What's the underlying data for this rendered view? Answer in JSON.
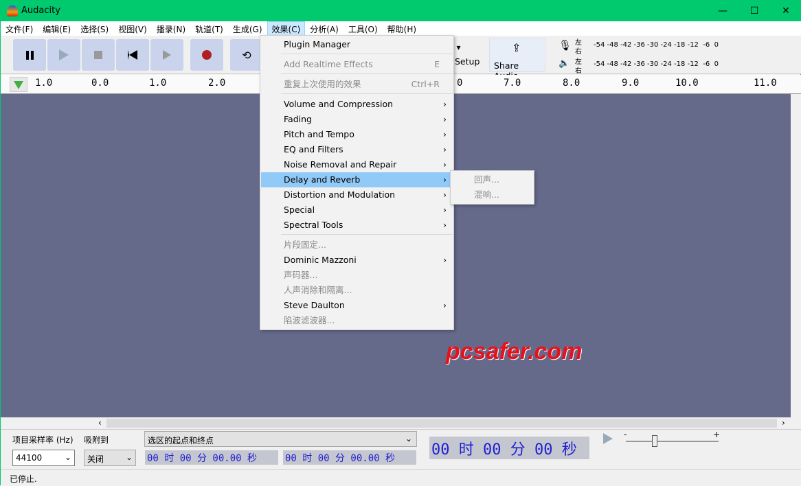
{
  "window": {
    "title": "Audacity",
    "minimize": "—",
    "maximize": "☐",
    "close": "✕"
  },
  "menubar": [
    "文件(F)",
    "编辑(E)",
    "选择(S)",
    "视图(V)",
    "播录(N)",
    "轨道(T)",
    "生成(G)",
    "效果(C)",
    "分析(A)",
    "工具(O)",
    "帮助(H)"
  ],
  "toolbar": {
    "setup_label": "Setup",
    "share_label": "Share Audio",
    "meter_left": "左",
    "meter_right": "右",
    "meter_scale": "-54 -48 -42 -36 -30 -24 -18 -12  -6  0"
  },
  "ruler": {
    "labels": [
      "1.0",
      "0.0",
      "1.0",
      "2.0",
      "0",
      "7.0",
      "8.0",
      "9.0",
      "10.0",
      "11.0"
    ]
  },
  "effects_menu": {
    "items": [
      {
        "label": "Plugin Manager",
        "enabled": true
      },
      {
        "label": "Add Realtime Effects",
        "shortcut": "E",
        "enabled": false
      },
      {
        "label": "重复上次使用的效果",
        "shortcut": "Ctrl+R",
        "enabled": false
      },
      {
        "label": "Volume and Compression",
        "submenu": true
      },
      {
        "label": "Fading",
        "submenu": true
      },
      {
        "label": "Pitch and Tempo",
        "submenu": true
      },
      {
        "label": "EQ and Filters",
        "submenu": true
      },
      {
        "label": "Noise Removal and Repair",
        "submenu": true
      },
      {
        "label": "Delay and Reverb",
        "submenu": true,
        "highlighted": true
      },
      {
        "label": "Distortion and Modulation",
        "submenu": true
      },
      {
        "label": "Special",
        "submenu": true
      },
      {
        "label": "Spectral Tools",
        "submenu": true
      },
      {
        "label": "片段固定...",
        "enabled": false
      },
      {
        "label": "Dominic Mazzoni",
        "submenu": true
      },
      {
        "label": "声码器...",
        "enabled": false
      },
      {
        "label": "人声消除和隔离...",
        "enabled": false
      },
      {
        "label": "Steve Daulton",
        "submenu": true
      },
      {
        "label": "陷波滤波器...",
        "enabled": false
      }
    ]
  },
  "submenu": {
    "items": [
      "回声...",
      "混响..."
    ]
  },
  "bottom": {
    "rate_label": "项目采样率 (Hz)",
    "snap_label": "吸附到",
    "rate_value": "44100",
    "snap_value": "关闭",
    "selection_mode": "选区的起点和终点",
    "sel_start": "00 时 00 分 00.00 秒",
    "sel_end": "00 时 00 分 00.00 秒",
    "position": "00 时 00 分 00 秒",
    "slider_min": "-",
    "slider_max": "+"
  },
  "status": {
    "text": "已停止."
  },
  "watermark": "pcsafer.com"
}
